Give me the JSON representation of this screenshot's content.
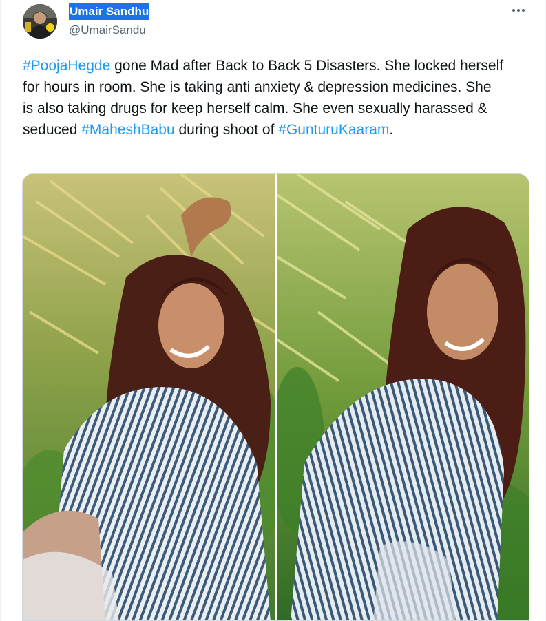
{
  "tweet": {
    "author": {
      "display_name": "Umair Sandhu",
      "handle": "@UmairSandu",
      "avatar_icon": "avatar-photo"
    },
    "more_icon": "more-options-icon",
    "text": {
      "hashtag_1": "#PoojaHegde",
      "segment_1": " gone Mad after Back to Back 5 Disasters. She locked herself for hours in room. She is taking anti anxiety & depression medicines. She is  also taking drugs for keep herself calm. She even sexually harassed & seduced ",
      "hashtag_2": "#MaheshBabu",
      "segment_2": " during shoot of ",
      "hashtag_3": "#GunturuKaaram",
      "segment_3": "."
    },
    "media": {
      "photo_count": 2,
      "photo_icons": [
        "photo-left",
        "photo-right"
      ]
    },
    "colors": {
      "link": "#1d9bf0",
      "text": "#0f1419",
      "secondary": "#536471",
      "name_highlight": "#1a73e8"
    }
  }
}
